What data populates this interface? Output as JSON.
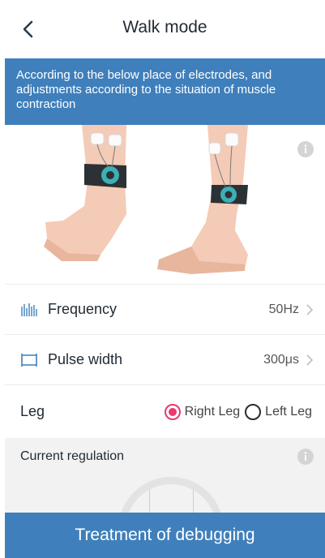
{
  "header": {
    "title": "Walk mode",
    "back_icon": "chevron-left-icon"
  },
  "banner": {
    "text": "According to the below place of electrodes, and adjustments according to the situation of muscle contraction"
  },
  "illustration": {
    "description_icon": "info-icon"
  },
  "settings": {
    "frequency": {
      "label": "Frequency",
      "value": "50Hz",
      "icon": "frequency-bars-icon"
    },
    "pulse_width": {
      "label": "Pulse width",
      "value": "300μs",
      "icon": "pulse-width-icon"
    }
  },
  "leg": {
    "label": "Leg",
    "options": [
      {
        "label": "Right Leg",
        "selected": true
      },
      {
        "label": "Left Leg",
        "selected": false
      }
    ]
  },
  "current_regulation": {
    "title": "Current regulation"
  },
  "action": {
    "label": "Treatment of debugging"
  },
  "colors": {
    "accent": "#3f7fbb",
    "radio_selected": "#e9396f",
    "panel_bg": "#f2f2f2"
  }
}
